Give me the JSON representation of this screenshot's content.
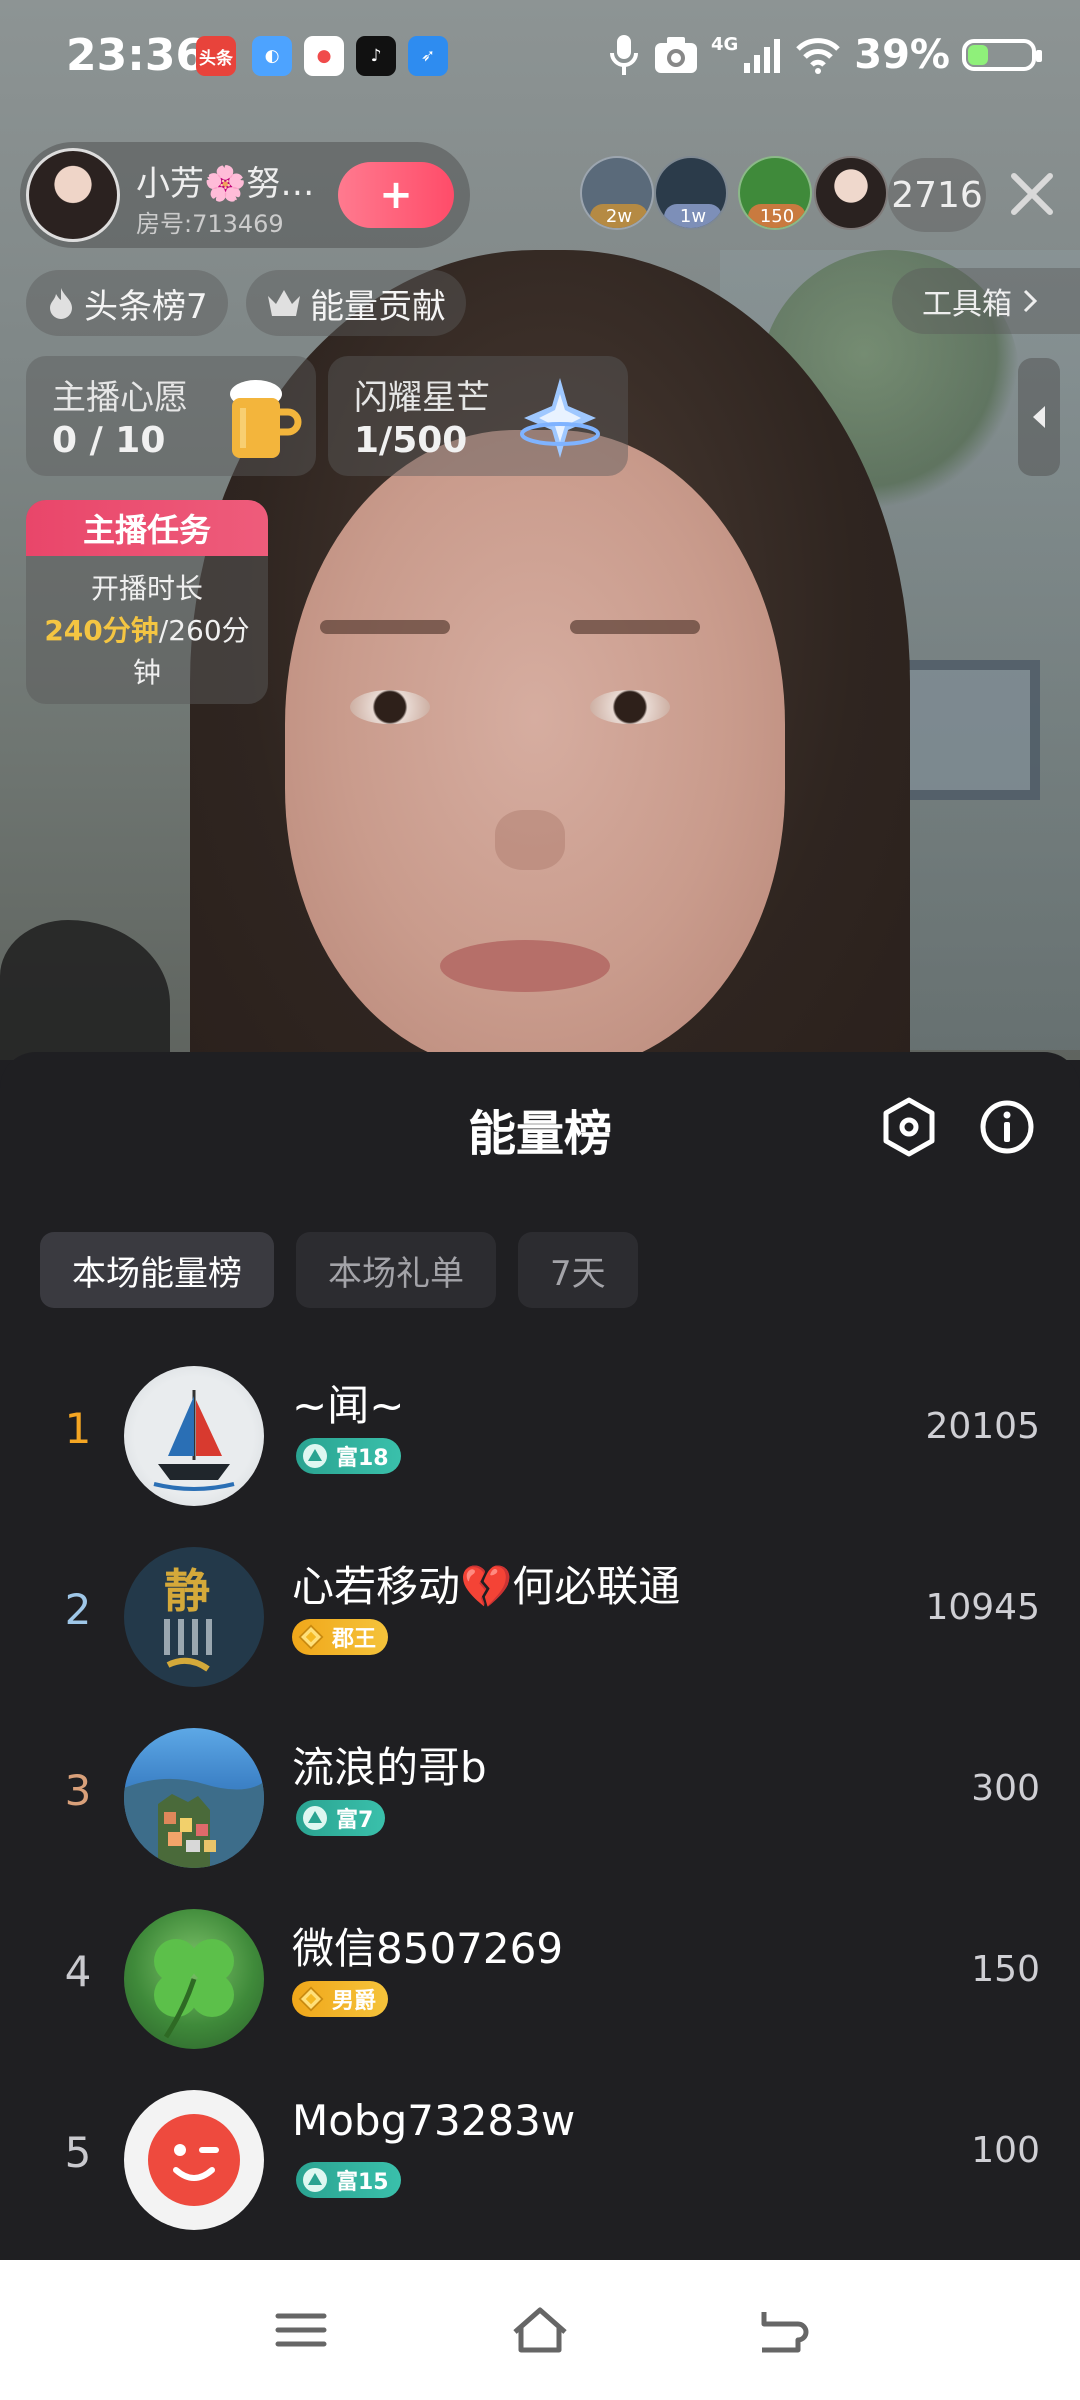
{
  "status_bar": {
    "time": "23:36",
    "battery": "39%",
    "network": "4G",
    "notification_apps": [
      {
        "name": "toutiao-app-icon",
        "label": "头条",
        "color": "#e8433b"
      },
      {
        "name": "wallet-app-icon",
        "label": "",
        "color": "#4da3ff"
      },
      {
        "name": "maps-app-icon",
        "label": "",
        "color": "#f04b4b"
      },
      {
        "name": "douyin-app-icon",
        "label": "",
        "color": "#111111"
      },
      {
        "name": "feather-app-icon",
        "label": "",
        "color": "#2e8cf0"
      }
    ]
  },
  "host": {
    "name": "小芳🌸努…",
    "room_id": "房号:713469",
    "follow_label": "+"
  },
  "viewers": {
    "top_viewers": [
      {
        "tag": "2w",
        "tag_color": "#b58a43",
        "avatar_color": "#5a6a7a"
      },
      {
        "tag": "1w",
        "tag_color": "#7d8fb8",
        "avatar_color": "#2b3b4a"
      },
      {
        "tag": "150",
        "tag_color": "#c97a3f",
        "avatar_color": "#3f8a3a"
      },
      {
        "tag": "",
        "tag_color": "",
        "avatar_color": "#d8c8c2"
      }
    ],
    "count": "2716"
  },
  "chips": {
    "headline_rank": "头条榜7",
    "energy_contribution": "能量贡献",
    "toolbox": "工具箱"
  },
  "goals": {
    "wish": {
      "title": "主播心愿",
      "value": "0 / 10"
    },
    "star": {
      "title": "闪耀星芒",
      "value": "1/500"
    }
  },
  "task": {
    "header": "主播任务",
    "label": "开播时长",
    "current": "240分钟",
    "total": "/260分钟"
  },
  "sheet": {
    "title": "能量榜",
    "tabs": [
      "本场能量榜",
      "本场礼单",
      "7天"
    ],
    "active_tab": 0,
    "ranking": [
      {
        "rank": "1",
        "rank_color": "#f5a623",
        "name": "~闻~",
        "badge": "富18",
        "badge_type": "rich",
        "score": "20105"
      },
      {
        "rank": "2",
        "rank_color": "#9fc7e8",
        "name": "心若移动💔何必联通",
        "badge": "郡王",
        "badge_type": "gold",
        "score": "10945"
      },
      {
        "rank": "3",
        "rank_color": "#d9a07a",
        "name": "流浪的哥b",
        "badge": "富7",
        "badge_type": "rich",
        "score": "300"
      },
      {
        "rank": "4",
        "rank_color": "#c9c9ce",
        "name": "微信8507269",
        "badge": "男爵",
        "badge_type": "gold",
        "score": "150"
      },
      {
        "rank": "5",
        "rank_color": "#c9c9ce",
        "name": "Mobg73283w",
        "badge": "富15",
        "badge_type": "rich",
        "score": "100"
      }
    ]
  }
}
